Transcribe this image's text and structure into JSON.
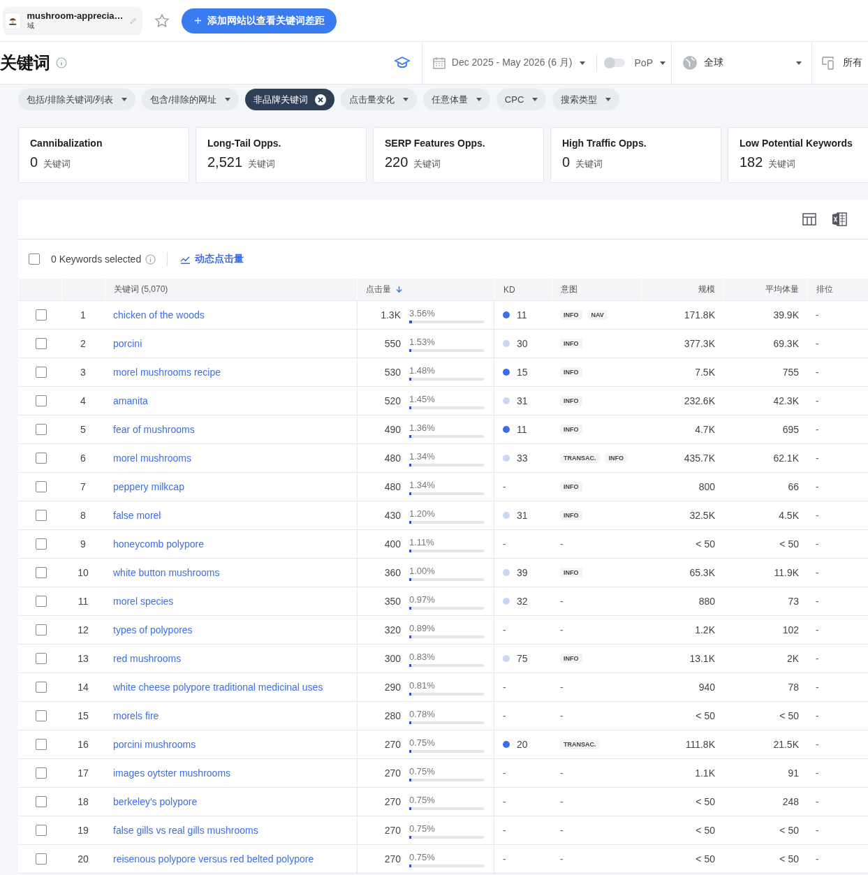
{
  "site": {
    "name": "mushroom-apprecia…",
    "type": "域"
  },
  "add_button": "添加网站以查看关键词差距",
  "title": "关键词",
  "date_range": "Dec 2025 - May 2026 (6 月)",
  "compare_toggle": {
    "on": false
  },
  "compare_mode": "PoP",
  "region": "全球",
  "device": "所有",
  "filters": [
    {
      "label": "包括/排除关键词/列表",
      "selected": false
    },
    {
      "label": "包含/排除的网址",
      "selected": false
    },
    {
      "label": "非品牌关键词",
      "selected": true
    },
    {
      "label": "点击量变化",
      "selected": false
    },
    {
      "label": "任意体量",
      "selected": false
    },
    {
      "label": "CPC",
      "selected": false
    },
    {
      "label": "搜索类型",
      "selected": false
    }
  ],
  "insights": [
    {
      "title": "Cannibalization",
      "value": "0",
      "unit": "关键词"
    },
    {
      "title": "Long-Tail Opps.",
      "value": "2,521",
      "unit": "关键词"
    },
    {
      "title": "SERP Features Opps.",
      "value": "220",
      "unit": "关键词"
    },
    {
      "title": "High Traffic Opps.",
      "value": "0",
      "unit": "关键词"
    },
    {
      "title": "Low Potential Keywords",
      "value": "182",
      "unit": "关键词"
    }
  ],
  "select_all": {
    "checked": false
  },
  "selection": "0 Keywords selected",
  "trend_link": "动态点击量",
  "columns": [
    {
      "label": "关键词 (5,070)",
      "sorted": false
    },
    {
      "label": "点击量",
      "sorted": true
    },
    {
      "label": "KD",
      "sorted": false
    },
    {
      "label": "意图",
      "sorted": false
    },
    {
      "label": "规模",
      "sorted": false
    },
    {
      "label": "平均体量",
      "sorted": false
    },
    {
      "label": "排位",
      "sorted": false
    }
  ],
  "rows": [
    {
      "checked": false,
      "rank": "1",
      "keyword": "chicken of the woods",
      "clicks": "1.3K",
      "share": "3.56%",
      "level": 0.0356,
      "kd": "11",
      "color": "#3b6ee8",
      "intents": [
        "INFO",
        "NAV"
      ],
      "volume": "171.8K",
      "avg": "39.9K",
      "position": "-"
    },
    {
      "checked": false,
      "rank": "2",
      "keyword": "porcini",
      "clicks": "550",
      "share": "1.53%",
      "level": 0.0153,
      "kd": "30",
      "color": "#c9d7f5",
      "intents": [
        "INFO"
      ],
      "volume": "377.3K",
      "avg": "69.3K",
      "position": "-"
    },
    {
      "checked": false,
      "rank": "3",
      "keyword": "morel mushrooms recipe",
      "clicks": "530",
      "share": "1.48%",
      "level": 0.0148,
      "kd": "15",
      "color": "#3b6ee8",
      "intents": [
        "INFO"
      ],
      "volume": "7.5K",
      "avg": "755",
      "position": "-"
    },
    {
      "checked": false,
      "rank": "4",
      "keyword": "amanita",
      "clicks": "520",
      "share": "1.45%",
      "level": 0.0145,
      "kd": "31",
      "color": "#c9d7f5",
      "intents": [
        "INFO"
      ],
      "volume": "232.6K",
      "avg": "42.3K",
      "position": "-"
    },
    {
      "checked": false,
      "rank": "5",
      "keyword": "fear of mushrooms",
      "clicks": "490",
      "share": "1.36%",
      "level": 0.0136,
      "kd": "11",
      "color": "#3b6ee8",
      "intents": [
        "INFO"
      ],
      "volume": "4.7K",
      "avg": "695",
      "position": "-"
    },
    {
      "checked": false,
      "rank": "6",
      "keyword": "morel mushrooms",
      "clicks": "480",
      "share": "1.34%",
      "level": 0.0134,
      "kd": "33",
      "color": "#c9d7f5",
      "intents": [
        "TRANSAC.",
        "INFO"
      ],
      "volume": "435.7K",
      "avg": "62.1K",
      "position": "-"
    },
    {
      "checked": false,
      "rank": "7",
      "keyword": "peppery milkcap",
      "clicks": "480",
      "share": "1.34%",
      "level": 0.0134,
      "kd": "-",
      "intents": [
        "INFO"
      ],
      "volume": "800",
      "avg": "66",
      "position": "-"
    },
    {
      "checked": false,
      "rank": "8",
      "keyword": "false morel",
      "clicks": "430",
      "share": "1.20%",
      "level": 0.012,
      "kd": "31",
      "color": "#c9d7f5",
      "intents": [
        "INFO"
      ],
      "volume": "32.5K",
      "avg": "4.5K",
      "position": "-"
    },
    {
      "checked": false,
      "rank": "9",
      "keyword": "honeycomb polypore",
      "clicks": "400",
      "share": "1.11%",
      "level": 0.0111,
      "kd": "-",
      "intent": "-",
      "volume": "< 50",
      "avg": "< 50",
      "position": "-"
    },
    {
      "checked": false,
      "rank": "10",
      "keyword": "white button mushrooms",
      "clicks": "360",
      "share": "1.00%",
      "level": 0.01,
      "kd": "39",
      "color": "#c9d7f5",
      "intents": [
        "INFO"
      ],
      "volume": "65.3K",
      "avg": "11.9K",
      "position": "-"
    },
    {
      "checked": false,
      "rank": "11",
      "keyword": "morel species",
      "clicks": "350",
      "share": "0.97%",
      "level": 0.0097,
      "kd": "32",
      "color": "#c9d7f5",
      "intent": "-",
      "volume": "880",
      "avg": "73",
      "position": "-"
    },
    {
      "checked": false,
      "rank": "12",
      "keyword": "types of polypores",
      "clicks": "320",
      "share": "0.89%",
      "level": 0.0089,
      "kd": "-",
      "intent": "-",
      "volume": "1.2K",
      "avg": "102",
      "position": "-"
    },
    {
      "checked": false,
      "rank": "13",
      "keyword": "red mushrooms",
      "clicks": "300",
      "share": "0.83%",
      "level": 0.0083,
      "kd": "75",
      "color": "#c9d7f5",
      "intents": [
        "INFO"
      ],
      "volume": "13.1K",
      "avg": "2K",
      "position": "-"
    },
    {
      "checked": false,
      "rank": "14",
      "keyword": "white cheese polypore traditional medicinal uses",
      "clicks": "290",
      "share": "0.81%",
      "level": 0.0081,
      "kd": "-",
      "intent": "-",
      "volume": "940",
      "avg": "78",
      "position": "-"
    },
    {
      "checked": false,
      "rank": "15",
      "keyword": "morels fire",
      "clicks": "280",
      "share": "0.78%",
      "level": 0.0078,
      "kd": "-",
      "intent": "-",
      "volume": "< 50",
      "avg": "< 50",
      "position": "-"
    },
    {
      "checked": false,
      "rank": "16",
      "keyword": "porcini mushrooms",
      "clicks": "270",
      "share": "0.75%",
      "level": 0.0075,
      "kd": "20",
      "color": "#3b6ee8",
      "intents": [
        "TRANSAC."
      ],
      "volume": "111.8K",
      "avg": "21.5K",
      "position": "-"
    },
    {
      "checked": false,
      "rank": "17",
      "keyword": "images oytster mushrooms",
      "clicks": "270",
      "share": "0.75%",
      "level": 0.0075,
      "kd": "-",
      "intent": "-",
      "volume": "1.1K",
      "avg": "91",
      "position": "-"
    },
    {
      "checked": false,
      "rank": "18",
      "keyword": "berkeley's polypore",
      "clicks": "270",
      "share": "0.75%",
      "level": 0.0075,
      "kd": "-",
      "intent": "-",
      "volume": "< 50",
      "avg": "248",
      "position": "-"
    },
    {
      "checked": false,
      "rank": "19",
      "keyword": "false gills vs real gills mushrooms",
      "clicks": "270",
      "share": "0.75%",
      "level": 0.0075,
      "kd": "-",
      "intent": "-",
      "volume": "< 50",
      "avg": "< 50",
      "position": "-"
    },
    {
      "checked": false,
      "rank": "20",
      "keyword": "reisenous polypore versus red belted polypore",
      "clicks": "270",
      "share": "0.75%",
      "level": 0.0075,
      "kd": "-",
      "intent": "-",
      "volume": "< 50",
      "avg": "< 50",
      "position": "-"
    }
  ]
}
